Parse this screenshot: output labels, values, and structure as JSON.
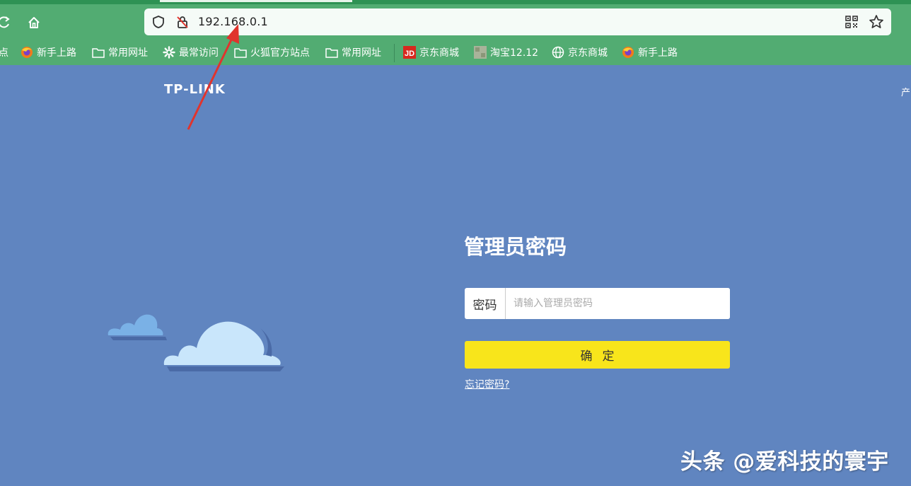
{
  "browser": {
    "url": "192.168.0.1",
    "bookmarks": [
      {
        "label": "点",
        "icon": "none"
      },
      {
        "label": "新手上路",
        "icon": "firefox-icon"
      },
      {
        "label": "常用网址",
        "icon": "folder-icon"
      },
      {
        "label": "最常访问",
        "icon": "gear-icon"
      },
      {
        "label": "火狐官方站点",
        "icon": "folder-icon"
      },
      {
        "label": "常用网址",
        "icon": "folder-icon"
      },
      {
        "label": "京东商城",
        "icon": "jd-icon"
      },
      {
        "label": "淘宝12.12",
        "icon": "taobao-icon"
      },
      {
        "label": "京东商城",
        "icon": "globe-icon"
      },
      {
        "label": "新手上路",
        "icon": "firefox-icon"
      }
    ]
  },
  "page": {
    "logo": "TP-LINK",
    "corner_text": "产",
    "title": "管理员密码",
    "password_label": "密码",
    "password_placeholder": "请输入管理员密码",
    "confirm_label": "确定",
    "forgot_link": "忘记密码?",
    "watermark": "头条 @爱科技的寰宇"
  },
  "colors": {
    "chrome_bg": "#52ac72",
    "page_bg": "#6085c0",
    "confirm_bg": "#f8e51b",
    "arrow": "#e0342d"
  }
}
